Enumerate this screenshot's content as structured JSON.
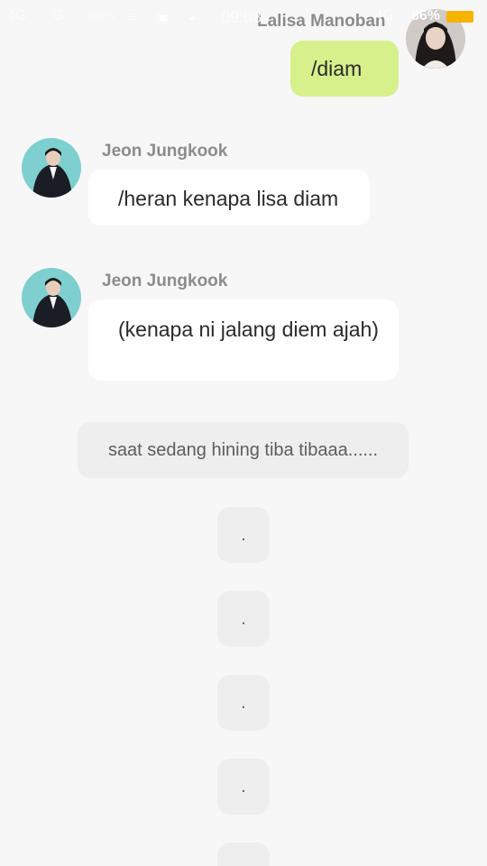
{
  "status_bar": {
    "signal_left": "4G",
    "signal_net": "G",
    "speed": "0K/s",
    "icons": "≡ ▣ ◕",
    "time": "09:08",
    "right_icons": "▫ 4G",
    "battery": "86%",
    "battery_color": "#f6b300"
  },
  "outgoing_sender": "Lalisa Manoban",
  "messages": [
    {
      "sender": "",
      "text": "/diam",
      "side": "out"
    },
    {
      "sender": "Jeon Jungkook",
      "text": "/heran kenapa lisa diam",
      "side": "in"
    },
    {
      "sender": "Jeon Jungkook",
      "text": "(kenapa ni jalang diem ajah)",
      "side": "in"
    }
  ],
  "narration": "saat sedang hining tiba tibaaa......",
  "dots": [
    ".",
    ".",
    ".",
    ".",
    "."
  ],
  "colors": {
    "background": "#f7f7f7",
    "bubble_out": "#d6f08c",
    "bubble_in": "#ffffff",
    "narration_bg": "#eeeeee",
    "avatar_in_bg": "#7ecfcf"
  }
}
